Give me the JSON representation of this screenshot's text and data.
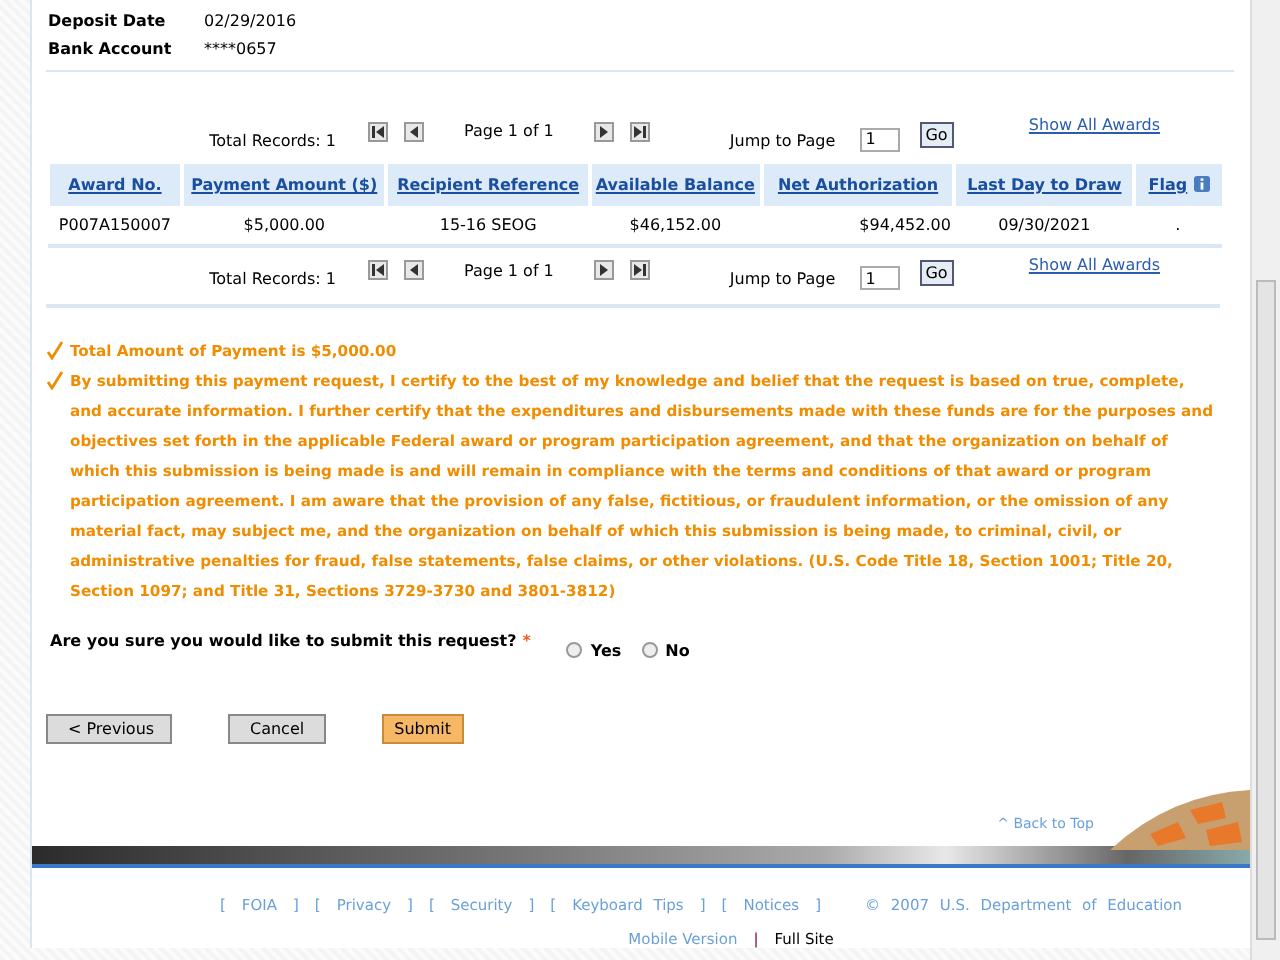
{
  "account": [
    {
      "label": "Deposit Date",
      "value": "02/29/2016"
    },
    {
      "label": "Bank Account",
      "value": "****0657"
    }
  ],
  "pagers": [
    {
      "total": "Total Records: 1",
      "page": "Page 1 of 1",
      "jump_label": "Jump to Page",
      "jump_value": "1",
      "go": "Go",
      "show_all": "Show All Awards"
    },
    {
      "total": "Total Records: 1",
      "page": "Page 1 of 1",
      "jump_label": "Jump to Page",
      "jump_value": "1",
      "go": "Go",
      "show_all": "Show All Awards"
    }
  ],
  "table": {
    "columns": [
      "Award No.",
      "Payment Amount ($)",
      "Recipient Reference",
      "Available Balance",
      "Net Authorization",
      "Last Day to Draw",
      "Flag"
    ],
    "rows": [
      [
        "P007A150007",
        "$5,000.00",
        "15-16 SEOG",
        "$46,152.00",
        "$94,452.00",
        "09/30/2021",
        "."
      ]
    ]
  },
  "notices": [
    "Total Amount of Payment is $5,000.00",
    "By submitting this payment request, I certify to the best of my knowledge and belief that the request is based on true, complete, and accurate information. I further certify that the expenditures and disbursements made with these funds are for the purposes and objectives set forth in the applicable Federal award or program participation agreement, and that the organization on behalf of which this submission is being made is and will remain in compliance with the terms and conditions of that award or program participation agreement. I am aware that the provision of any false, fictitious, or fraudulent information, or the omission of any material fact, may subject me, and the organization on behalf of which this submission is being made, to criminal, civil, or administrative penalties for fraud, false statements, false claims, or other violations. (U.S. Code Title 18, Section 1001; Title 20, Section 1097; and Title 31, Sections 3729-3730 and 3801-3812)"
  ],
  "question": {
    "text": "Are you sure you would like to submit this request?",
    "required": "*",
    "options": [
      {
        "label": "Yes",
        "selected": false
      },
      {
        "label": "No",
        "selected": false
      }
    ]
  },
  "buttons": [
    {
      "label": "< Previous",
      "kind": "default"
    },
    {
      "label": "Cancel",
      "kind": "default"
    },
    {
      "label": "Submit",
      "kind": "primary"
    }
  ],
  "back_to_top": "^ Back to Top",
  "footer": {
    "open": "[",
    "close": "]",
    "links": [
      "FOIA",
      "Privacy",
      "Security",
      "Keyboard Tips",
      "Notices"
    ],
    "copyright": "© 2007 U.S. Department of Education",
    "views": [
      {
        "label": "Mobile Version",
        "selected": false
      },
      {
        "label": "Full Site",
        "selected": true
      }
    ],
    "separator": "|"
  }
}
